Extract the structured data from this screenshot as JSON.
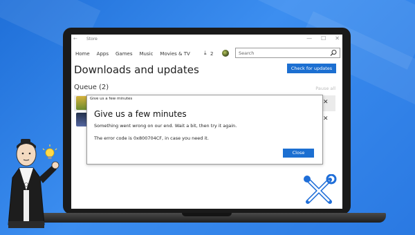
{
  "app": {
    "title": "Store"
  },
  "window_controls": [
    "—",
    "☐",
    "✕"
  ],
  "nav": {
    "items": [
      "Home",
      "Apps",
      "Games",
      "Music",
      "Movies & TV"
    ],
    "downloads_count": "2",
    "search_placeholder": "Search"
  },
  "page": {
    "title": "Downloads and updates",
    "check_button": "Check for updates",
    "queue_label": "Queue (2)",
    "pause_all": "Pause all"
  },
  "dialog": {
    "titlebar": "Give us a few minutes",
    "heading": "Give us a few minutes",
    "message": "Something went wrong on our end. Wait a bit, then try it again.",
    "error_text": "The error code is 0x800704CF, in case you need it.",
    "close_button": "Close"
  },
  "colors": {
    "accent": "#1c6fd1",
    "background": "#2f7fe0",
    "bezel": "#1a1a1a"
  },
  "icons": [
    "back-arrow-icon",
    "download-icon",
    "search-icon",
    "close-icon",
    "tools-icon",
    "lightbulb-icon"
  ]
}
